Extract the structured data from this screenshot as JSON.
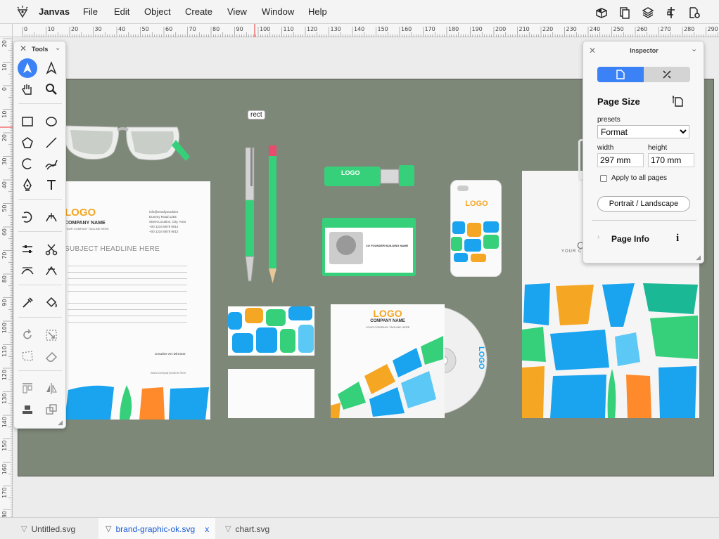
{
  "app": {
    "name": "Janvas"
  },
  "menu": [
    "File",
    "Edit",
    "Object",
    "Create",
    "View",
    "Window",
    "Help"
  ],
  "toolbar_icons": [
    "boxes-icon",
    "copy-pages-icon",
    "layers-icon",
    "align-icon",
    "document-settings-icon"
  ],
  "ruler": {
    "h_labels": [
      "0",
      "10",
      "20",
      "30",
      "40",
      "50",
      "60",
      "70",
      "80",
      "90",
      "100",
      "110",
      "120",
      "130",
      "140",
      "150",
      "160",
      "170",
      "180",
      "190",
      "200",
      "210",
      "220",
      "230",
      "240",
      "250",
      "260",
      "270",
      "280",
      "290"
    ],
    "v_labels": [
      "20",
      "10",
      "0",
      "10",
      "20",
      "30",
      "40",
      "50",
      "60",
      "70",
      "80",
      "90",
      "100",
      "110",
      "120",
      "130",
      "140",
      "150",
      "160",
      "170",
      "180"
    ]
  },
  "tools_panel": {
    "title": "Tools"
  },
  "canvas": {
    "tooltip": "rect"
  },
  "inspector": {
    "title": "Inspector",
    "section_title": "Page Size",
    "presets_label": "presets",
    "presets_value": "Format",
    "width_label": "width",
    "width_value": "297 mm",
    "height_label": "height",
    "height_value": "170 mm",
    "apply_all_label": "Apply to all pages",
    "orientation_button": "Portrait / Landscape",
    "page_info_label": "Page Info",
    "info_glyph": "i"
  },
  "artwork": {
    "logo": "LOGO",
    "company": "COMPANY NAME",
    "tagline": "YOUR COMPANY TAGLINE HERE",
    "headline": "SUBJECT HEADLINE HERE",
    "badge_name": "CO FOUNDER BUILDING NAME",
    "role": "Creative Art Director",
    "website": "www.companyname.here",
    "email": "info@emailyourdolor",
    "address1": "Dummy Road 1254",
    "address2": "Street Location, City, Area",
    "phone1": "+00 1234 5678 9012",
    "phone2": "+00 1234 5678 9012",
    "bag_company": "YOUR C"
  },
  "tabs": [
    {
      "label": "Untitled.svg",
      "active": false
    },
    {
      "label": "brand-graphic-ok.svg",
      "active": true,
      "close": "x"
    },
    {
      "label": "chart.svg",
      "active": false
    }
  ],
  "colors": {
    "accent": "#3a82f6",
    "artboard": "#7e8878",
    "green": "#36d07a",
    "blue": "#1aa3ee",
    "orange": "#f5a623"
  }
}
